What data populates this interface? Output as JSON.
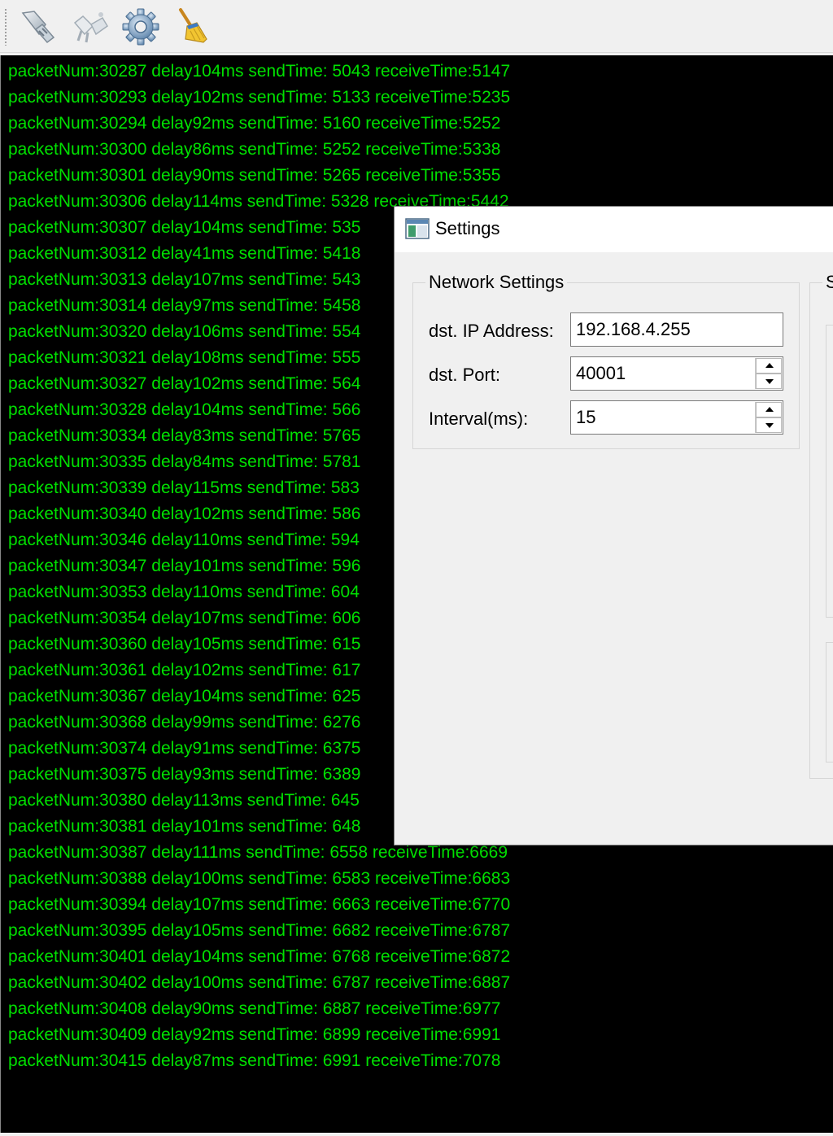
{
  "toolbar": {
    "buttons": [
      {
        "icon": "connect-plug-icon"
      },
      {
        "icon": "disconnect-plug-icon"
      },
      {
        "icon": "gear-icon"
      },
      {
        "icon": "broom-icon"
      }
    ]
  },
  "console": {
    "text_color": "#00e000",
    "background": "#000000",
    "lines": [
      "packetNum:30287 delay104ms sendTime: 5043 receiveTime:5147",
      "packetNum:30293 delay102ms sendTime: 5133 receiveTime:5235",
      "packetNum:30294 delay92ms sendTime: 5160 receiveTime:5252",
      "packetNum:30300 delay86ms sendTime: 5252 receiveTime:5338",
      "packetNum:30301 delay90ms sendTime: 5265 receiveTime:5355",
      "packetNum:30306 delay114ms sendTime: 5328 receiveTime:5442",
      "packetNum:30307 delay104ms sendTime: 535",
      "packetNum:30312 delay41ms sendTime: 5418",
      "packetNum:30313 delay107ms sendTime: 543",
      "packetNum:30314 delay97ms sendTime: 5458",
      "packetNum:30320 delay106ms sendTime: 554",
      "packetNum:30321 delay108ms sendTime: 555",
      "packetNum:30327 delay102ms sendTime: 564",
      "packetNum:30328 delay104ms sendTime: 566",
      "packetNum:30334 delay83ms sendTime: 5765",
      "packetNum:30335 delay84ms sendTime: 5781",
      "packetNum:30339 delay115ms sendTime: 583",
      "packetNum:30340 delay102ms sendTime: 586",
      "packetNum:30346 delay110ms sendTime: 594",
      "packetNum:30347 delay101ms sendTime: 596",
      "packetNum:30353 delay110ms sendTime: 604",
      "packetNum:30354 delay107ms sendTime: 606",
      "packetNum:30360 delay105ms sendTime: 615",
      "packetNum:30361 delay102ms sendTime: 617",
      "packetNum:30367 delay104ms sendTime: 625",
      "packetNum:30368 delay99ms sendTime: 6276",
      "packetNum:30374 delay91ms sendTime: 6375",
      "packetNum:30375 delay93ms sendTime: 6389",
      "packetNum:30380 delay113ms sendTime: 645",
      "packetNum:30381 delay101ms sendTime: 648",
      "packetNum:30387 delay111ms sendTime: 6558 receiveTime:6669",
      "packetNum:30388 delay100ms sendTime: 6583 receiveTime:6683",
      "packetNum:30394 delay107ms sendTime: 6663 receiveTime:6770",
      "packetNum:30395 delay105ms sendTime: 6682 receiveTime:6787",
      "packetNum:30401 delay104ms sendTime: 6768 receiveTime:6872",
      "packetNum:30402 delay100ms sendTime: 6787 receiveTime:6887",
      "packetNum:30408 delay90ms sendTime: 6887 receiveTime:6977",
      "packetNum:30409 delay92ms sendTime: 6899 receiveTime:6991",
      "packetNum:30415 delay87ms sendTime: 6991 receiveTime:7078"
    ]
  },
  "dialog": {
    "title": "Settings",
    "title_icon": "window-icon",
    "network_group": {
      "title": "Network Settings",
      "fields": {
        "ip": {
          "label": "dst. IP Address:",
          "value": "192.168.4.255"
        },
        "port": {
          "label": "dst. Port:",
          "value": "40001"
        },
        "interval": {
          "label": "Interval(ms):",
          "value": "15"
        }
      }
    },
    "second_group": {
      "title": "S"
    }
  }
}
